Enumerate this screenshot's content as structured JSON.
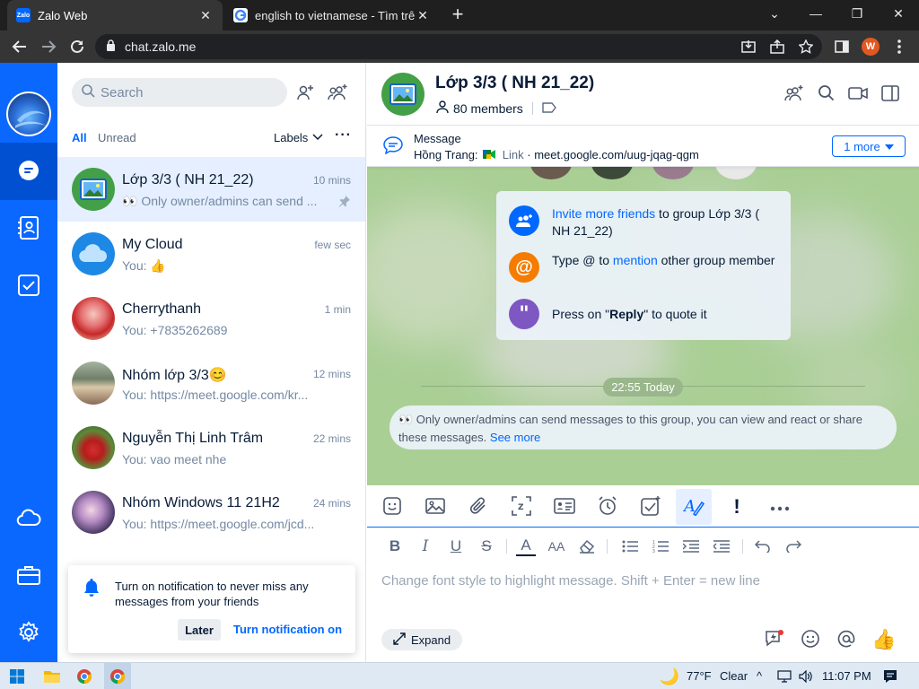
{
  "browser": {
    "tabs": [
      {
        "title": "Zalo Web",
        "favicon": "zalo-icon"
      },
      {
        "title": "english to vietnamese - Tìm trên",
        "favicon": "google-icon"
      }
    ],
    "url": "chat.zalo.me",
    "profile_initial": "W"
  },
  "nav": {
    "items": [
      "messages-icon",
      "contacts-icon",
      "todo-icon",
      "cloud-icon",
      "toolbox-icon",
      "settings-icon"
    ],
    "accent": "#0a68ff"
  },
  "sidebar": {
    "search_placeholder": "Search",
    "filter_all": "All",
    "filter_unread": "Unread",
    "labels": "Labels",
    "conversations": [
      {
        "name": "Lớp 3/3 ( NH 21_22)",
        "preview": "👀 Only owner/admins can send ...",
        "time": "10 mins",
        "pinned": true
      },
      {
        "name": "My Cloud",
        "preview": "You: 👍",
        "time": "few sec"
      },
      {
        "name": "Cherrythanh",
        "preview": "You: +7835262689",
        "time": "1 min"
      },
      {
        "name": "Nhóm lớp 3/3😊",
        "preview": "You: https://meet.google.com/kr...",
        "time": "12 mins"
      },
      {
        "name": "Nguyễn Thị Linh Trâm",
        "preview": "You: vao meet nhe",
        "time": "22 mins"
      },
      {
        "name": "Nhóm Windows 11 21H2",
        "preview": "You: https://meet.google.com/jcd...",
        "time": "24 mins"
      }
    ],
    "notification": {
      "message": "Turn on notification to never miss any messages from your friends",
      "later": "Later",
      "turn_on": "Turn notification on"
    }
  },
  "chat": {
    "group_name": "Lớp 3/3 ( NH 21_22)",
    "members": "80 members",
    "pinned": {
      "label": "Message",
      "sender": "Hồng Trang:",
      "link_label": "Link",
      "link_text": "· meet.google.com/uug-jqag-qgm",
      "more": "1 more"
    },
    "tips": {
      "invite_link": "Invite more friends",
      "invite_rest": " to group Lớp 3/3 ( NH 21_22)",
      "mention_pre": "Type @ to ",
      "mention_link": "mention",
      "mention_rest": " other group member",
      "reply_pre": "Press on \"",
      "reply_bold": "Reply",
      "reply_rest": "\" to quote it"
    },
    "time_divider": "22:55 Today",
    "system_message": "👀 Only owner/admins can send messages to this group, you can view and react or share these messages.",
    "see_more": "See more"
  },
  "composer": {
    "placeholder": "Change font style to highlight message. Shift + Enter = new line",
    "expand": "Expand",
    "quick_reaction": "👍"
  },
  "taskbar": {
    "temperature": "77°F",
    "weather": "Clear",
    "time": "11:07 PM"
  }
}
